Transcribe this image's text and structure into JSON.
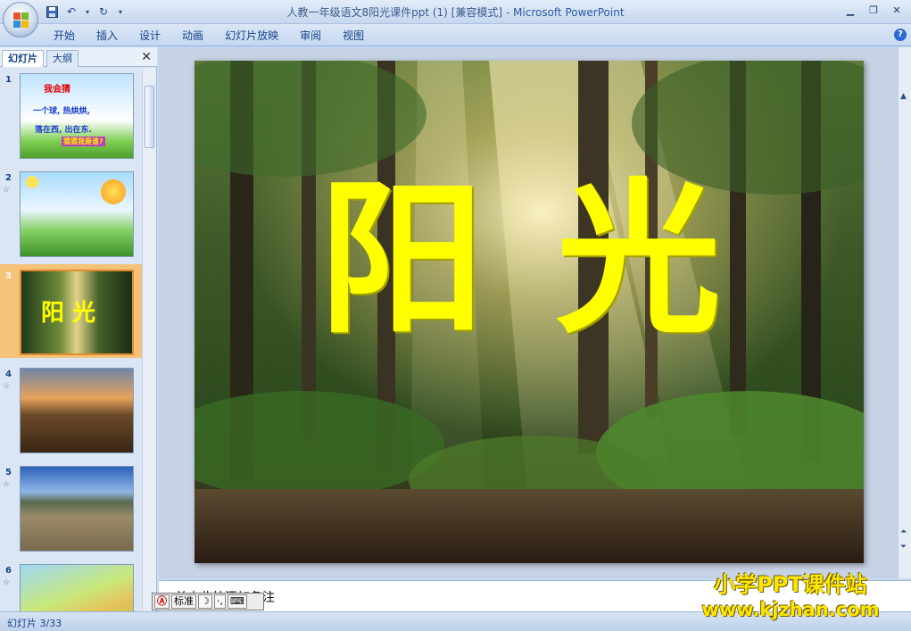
{
  "window": {
    "title": "人教一年级语文8阳光课件ppt (1) [兼容模式]",
    "app_name": "Microsoft PowerPoint"
  },
  "ribbon": {
    "tabs": [
      "开始",
      "插入",
      "设计",
      "动画",
      "幻灯片放映",
      "审阅",
      "视图"
    ]
  },
  "left_pane": {
    "tabs": [
      "幻灯片",
      "大纲"
    ],
    "thumbnails": [
      {
        "number": "1",
        "title": "我会猜",
        "lines": [
          "一个球, 热烘烘,",
          "落在西, 出在东.",
          "猜猜我是谁?"
        ]
      },
      {
        "number": "2"
      },
      {
        "number": "3",
        "title": "阳 光"
      },
      {
        "number": "4"
      },
      {
        "number": "5"
      },
      {
        "number": "6"
      }
    ]
  },
  "slide": {
    "title": "阳光"
  },
  "notes": {
    "placeholder": "单击此处添加备注"
  },
  "ime": {
    "mode": "标准"
  },
  "status": {
    "slide_indicator": "幻灯片 3/33"
  },
  "watermark": {
    "line1": "小学PPT课件站",
    "line2": "www.kjzhan.com"
  },
  "colors": {
    "accent": "#15428b",
    "slide_title": "#ffff00",
    "selected_thumb": "#f5c27a"
  }
}
